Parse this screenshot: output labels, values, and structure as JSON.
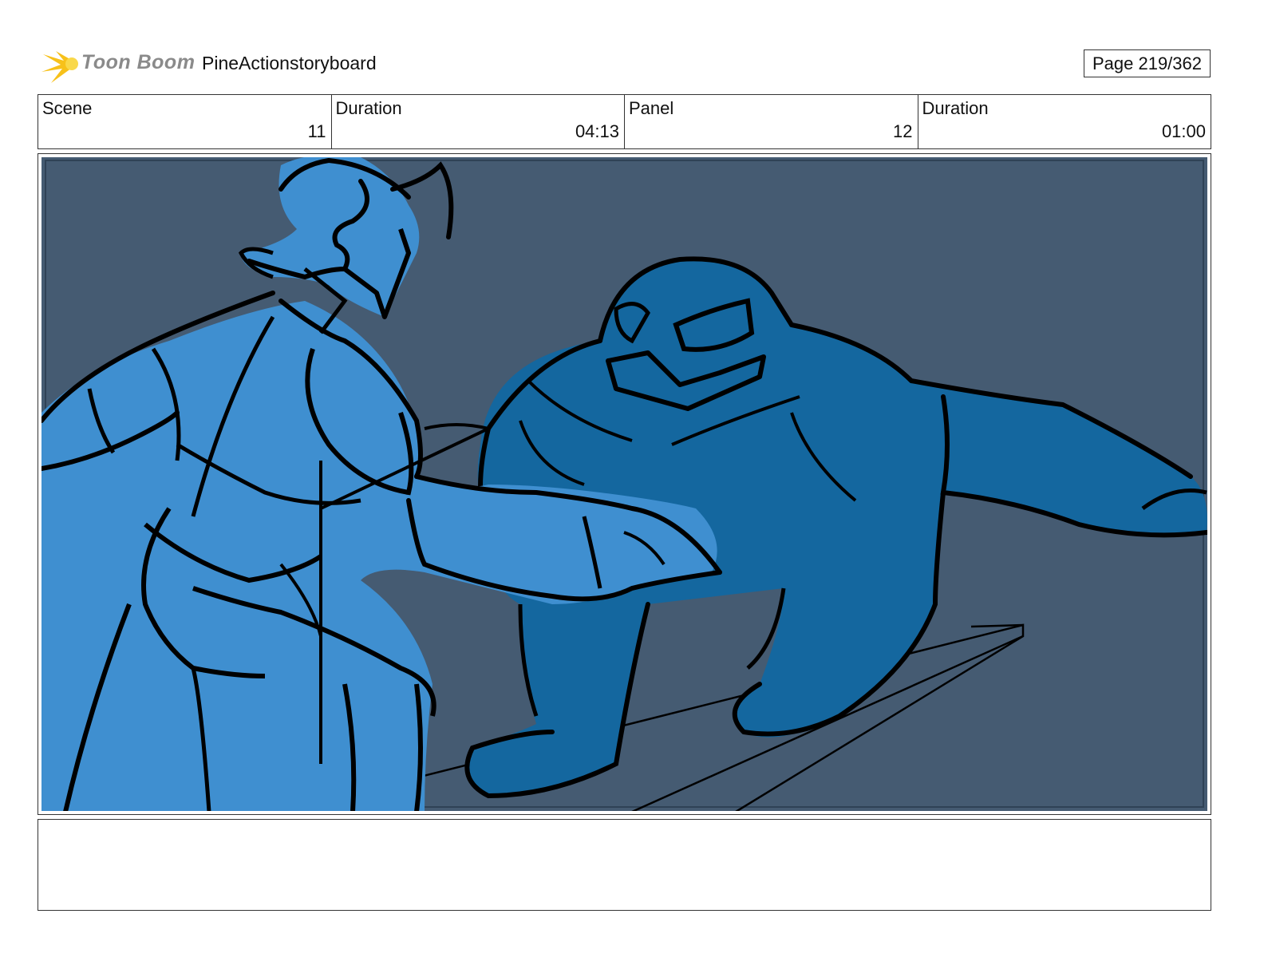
{
  "header": {
    "logo_text": "Toon Boom",
    "project_title": "PineActionstoryboard",
    "page_label": "Page 219/362"
  },
  "info": {
    "scene_label": "Scene",
    "scene_value": "11",
    "scene_duration_label": "Duration",
    "scene_duration_value": "04:13",
    "panel_label": "Panel",
    "panel_value": "12",
    "panel_duration_label": "Duration",
    "panel_duration_value": "01:00"
  },
  "notes": {
    "text": ""
  },
  "colors": {
    "background": "#455b72",
    "hero_fill": "#3f8fd0",
    "creature_fill": "#14679f",
    "line": "#000000",
    "logo_star": "#f7c11a"
  }
}
